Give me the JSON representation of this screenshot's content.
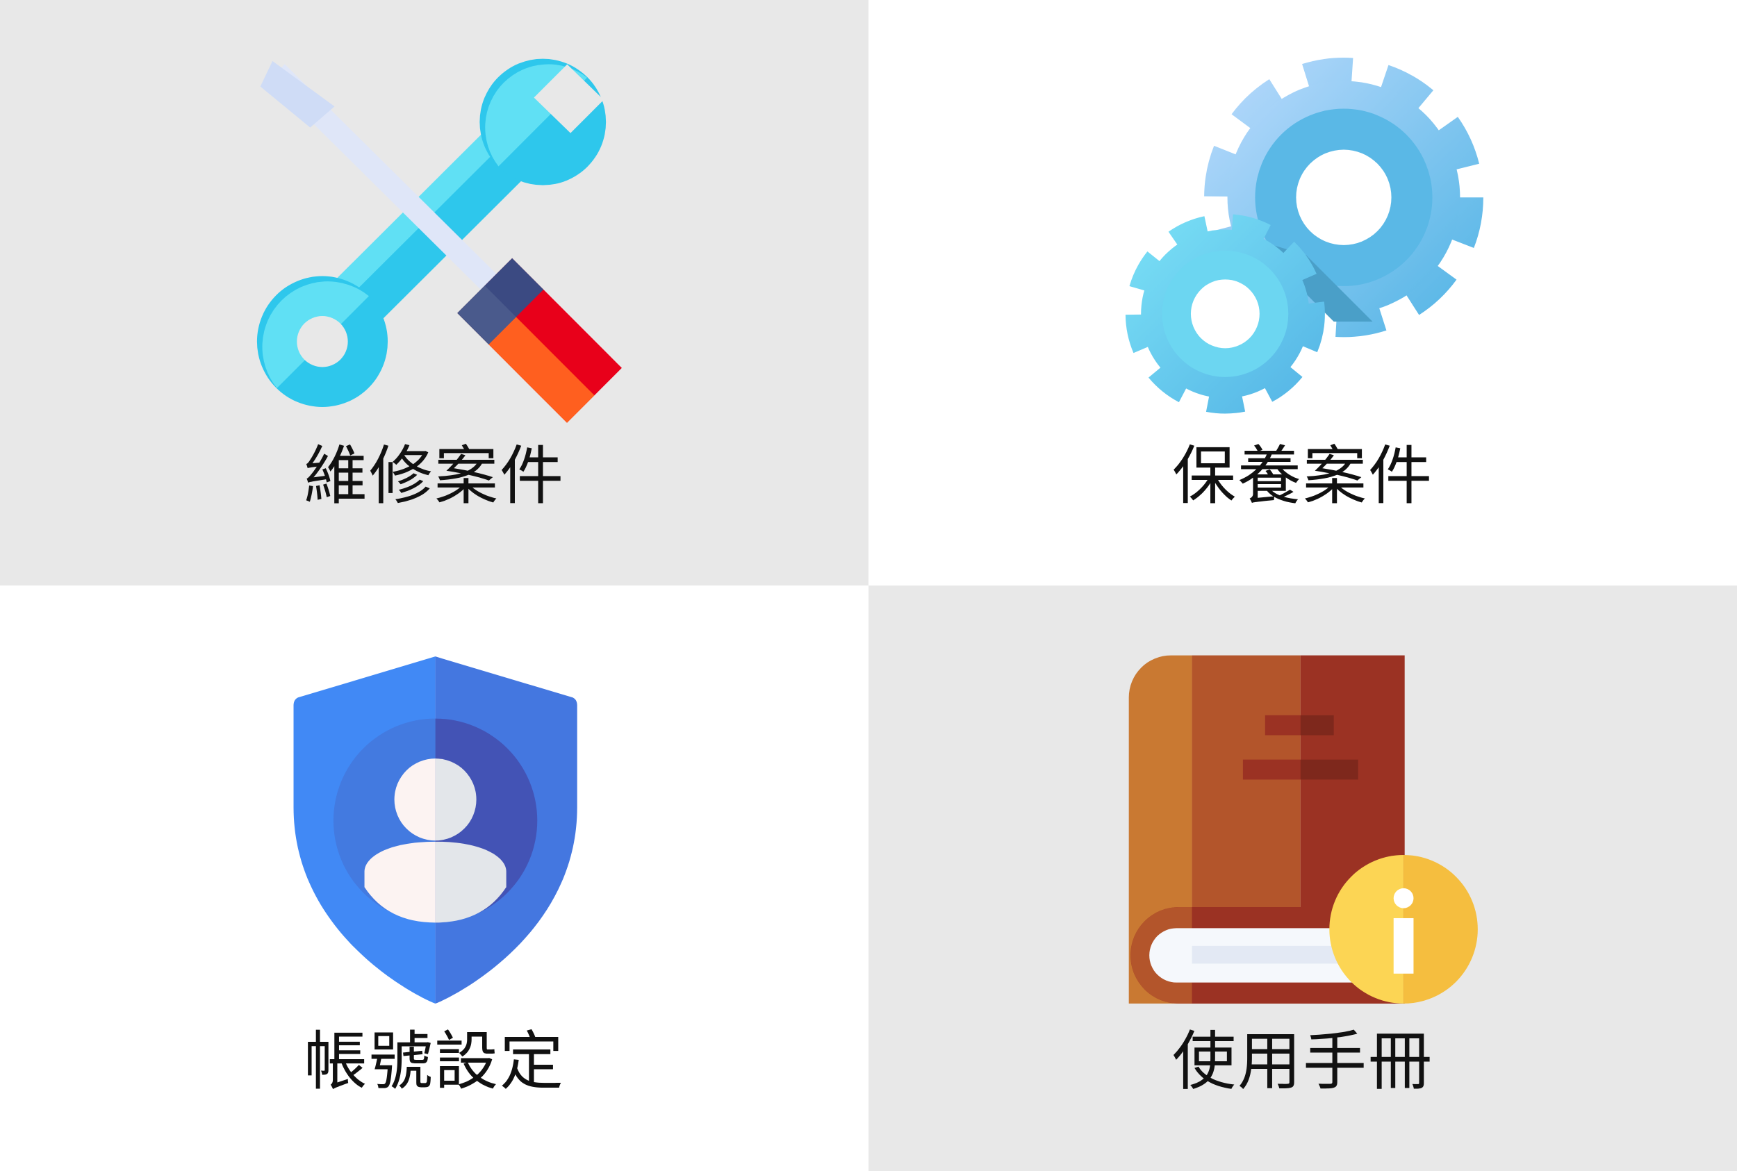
{
  "tiles": [
    {
      "label": "維修案件",
      "icon": "wrench-screwdriver-icon",
      "background": "#e8e8e8"
    },
    {
      "label": "保養案件",
      "icon": "gears-icon",
      "background": "#ffffff"
    },
    {
      "label": "帳號設定",
      "icon": "shield-user-icon",
      "background": "#ffffff"
    },
    {
      "label": "使用手冊",
      "icon": "manual-book-info-icon",
      "background": "#e8e8e8"
    }
  ]
}
